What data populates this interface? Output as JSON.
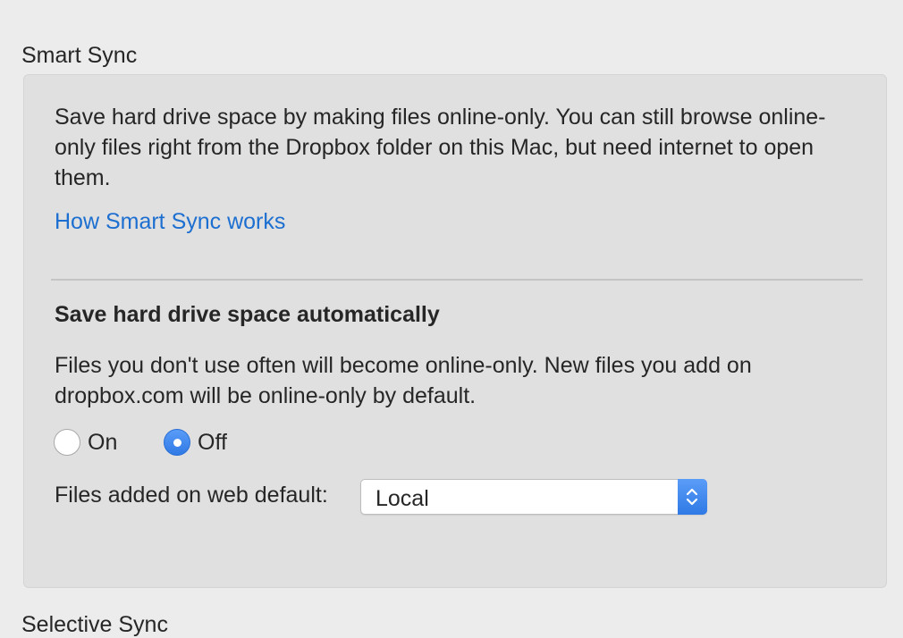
{
  "smart_sync": {
    "section_title": "Smart Sync",
    "description": "Save hard drive space by making files online-only. You can still browse online-only files right from the Dropbox folder on this Mac, but need internet to open them.",
    "help_link": "How Smart Sync works",
    "auto_save": {
      "heading": "Save hard drive space automatically",
      "description": "Files you don't use often will become online-only. New files you add on dropbox.com will be online-only by default.",
      "options": [
        {
          "label": "On",
          "selected": false
        },
        {
          "label": "Off",
          "selected": true
        }
      ]
    },
    "web_default": {
      "label": "Files added on web default:",
      "selected_value": "Local"
    }
  },
  "selective_sync": {
    "section_title": "Selective Sync"
  },
  "icons": {
    "select_arrows": "chevron-up-down-icon",
    "radio_selected": "radio-selected-icon",
    "radio_unselected": "radio-unselected-icon"
  },
  "colors": {
    "accent": "#2f7ae5",
    "link": "#1c6fd1",
    "panel_background": "#e0e0e0",
    "window_background": "#ececec"
  }
}
